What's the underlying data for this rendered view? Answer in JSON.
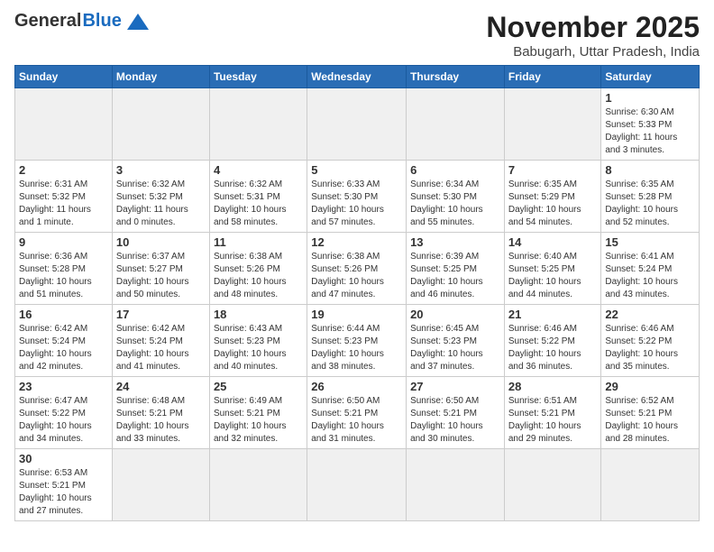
{
  "logo": {
    "general": "General",
    "blue": "Blue"
  },
  "title": {
    "month_year": "November 2025",
    "location": "Babugarh, Uttar Pradesh, India"
  },
  "weekdays": [
    "Sunday",
    "Monday",
    "Tuesday",
    "Wednesday",
    "Thursday",
    "Friday",
    "Saturday"
  ],
  "weeks": [
    [
      {
        "day": "",
        "info": ""
      },
      {
        "day": "",
        "info": ""
      },
      {
        "day": "",
        "info": ""
      },
      {
        "day": "",
        "info": ""
      },
      {
        "day": "",
        "info": ""
      },
      {
        "day": "",
        "info": ""
      },
      {
        "day": "1",
        "info": "Sunrise: 6:30 AM\nSunset: 5:33 PM\nDaylight: 11 hours\nand 3 minutes."
      }
    ],
    [
      {
        "day": "2",
        "info": "Sunrise: 6:31 AM\nSunset: 5:32 PM\nDaylight: 11 hours\nand 1 minute."
      },
      {
        "day": "3",
        "info": "Sunrise: 6:32 AM\nSunset: 5:32 PM\nDaylight: 11 hours\nand 0 minutes."
      },
      {
        "day": "4",
        "info": "Sunrise: 6:32 AM\nSunset: 5:31 PM\nDaylight: 10 hours\nand 58 minutes."
      },
      {
        "day": "5",
        "info": "Sunrise: 6:33 AM\nSunset: 5:30 PM\nDaylight: 10 hours\nand 57 minutes."
      },
      {
        "day": "6",
        "info": "Sunrise: 6:34 AM\nSunset: 5:30 PM\nDaylight: 10 hours\nand 55 minutes."
      },
      {
        "day": "7",
        "info": "Sunrise: 6:35 AM\nSunset: 5:29 PM\nDaylight: 10 hours\nand 54 minutes."
      },
      {
        "day": "8",
        "info": "Sunrise: 6:35 AM\nSunset: 5:28 PM\nDaylight: 10 hours\nand 52 minutes."
      }
    ],
    [
      {
        "day": "9",
        "info": "Sunrise: 6:36 AM\nSunset: 5:28 PM\nDaylight: 10 hours\nand 51 minutes."
      },
      {
        "day": "10",
        "info": "Sunrise: 6:37 AM\nSunset: 5:27 PM\nDaylight: 10 hours\nand 50 minutes."
      },
      {
        "day": "11",
        "info": "Sunrise: 6:38 AM\nSunset: 5:26 PM\nDaylight: 10 hours\nand 48 minutes."
      },
      {
        "day": "12",
        "info": "Sunrise: 6:38 AM\nSunset: 5:26 PM\nDaylight: 10 hours\nand 47 minutes."
      },
      {
        "day": "13",
        "info": "Sunrise: 6:39 AM\nSunset: 5:25 PM\nDaylight: 10 hours\nand 46 minutes."
      },
      {
        "day": "14",
        "info": "Sunrise: 6:40 AM\nSunset: 5:25 PM\nDaylight: 10 hours\nand 44 minutes."
      },
      {
        "day": "15",
        "info": "Sunrise: 6:41 AM\nSunset: 5:24 PM\nDaylight: 10 hours\nand 43 minutes."
      }
    ],
    [
      {
        "day": "16",
        "info": "Sunrise: 6:42 AM\nSunset: 5:24 PM\nDaylight: 10 hours\nand 42 minutes."
      },
      {
        "day": "17",
        "info": "Sunrise: 6:42 AM\nSunset: 5:24 PM\nDaylight: 10 hours\nand 41 minutes."
      },
      {
        "day": "18",
        "info": "Sunrise: 6:43 AM\nSunset: 5:23 PM\nDaylight: 10 hours\nand 40 minutes."
      },
      {
        "day": "19",
        "info": "Sunrise: 6:44 AM\nSunset: 5:23 PM\nDaylight: 10 hours\nand 38 minutes."
      },
      {
        "day": "20",
        "info": "Sunrise: 6:45 AM\nSunset: 5:23 PM\nDaylight: 10 hours\nand 37 minutes."
      },
      {
        "day": "21",
        "info": "Sunrise: 6:46 AM\nSunset: 5:22 PM\nDaylight: 10 hours\nand 36 minutes."
      },
      {
        "day": "22",
        "info": "Sunrise: 6:46 AM\nSunset: 5:22 PM\nDaylight: 10 hours\nand 35 minutes."
      }
    ],
    [
      {
        "day": "23",
        "info": "Sunrise: 6:47 AM\nSunset: 5:22 PM\nDaylight: 10 hours\nand 34 minutes."
      },
      {
        "day": "24",
        "info": "Sunrise: 6:48 AM\nSunset: 5:21 PM\nDaylight: 10 hours\nand 33 minutes."
      },
      {
        "day": "25",
        "info": "Sunrise: 6:49 AM\nSunset: 5:21 PM\nDaylight: 10 hours\nand 32 minutes."
      },
      {
        "day": "26",
        "info": "Sunrise: 6:50 AM\nSunset: 5:21 PM\nDaylight: 10 hours\nand 31 minutes."
      },
      {
        "day": "27",
        "info": "Sunrise: 6:50 AM\nSunset: 5:21 PM\nDaylight: 10 hours\nand 30 minutes."
      },
      {
        "day": "28",
        "info": "Sunrise: 6:51 AM\nSunset: 5:21 PM\nDaylight: 10 hours\nand 29 minutes."
      },
      {
        "day": "29",
        "info": "Sunrise: 6:52 AM\nSunset: 5:21 PM\nDaylight: 10 hours\nand 28 minutes."
      }
    ],
    [
      {
        "day": "30",
        "info": "Sunrise: 6:53 AM\nSunset: 5:21 PM\nDaylight: 10 hours\nand 27 minutes."
      },
      {
        "day": "",
        "info": ""
      },
      {
        "day": "",
        "info": ""
      },
      {
        "day": "",
        "info": ""
      },
      {
        "day": "",
        "info": ""
      },
      {
        "day": "",
        "info": ""
      },
      {
        "day": "",
        "info": ""
      }
    ]
  ]
}
